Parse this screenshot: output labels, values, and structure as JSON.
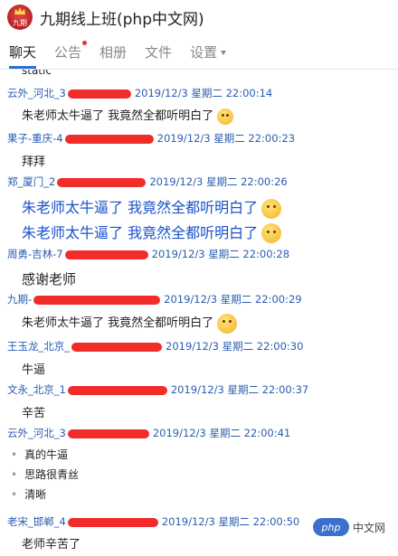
{
  "header": {
    "title": "九期线上班(php中文网)",
    "logo_text": "九期"
  },
  "tabs": [
    {
      "label": "聊天"
    },
    {
      "label": "公告"
    },
    {
      "label": "相册"
    },
    {
      "label": "文件"
    },
    {
      "label": "设置"
    }
  ],
  "messages": {
    "prev_text": "static",
    "m1": {
      "sender": "云外_河北_3",
      "time": "2019/12/3 星期二 22:00:14",
      "text": "朱老师太牛逼了 我竟然全都听明白了"
    },
    "m2": {
      "sender": "果子-重庆-4",
      "time": "2019/12/3 星期二 22:00:23",
      "text": "拜拜"
    },
    "m3": {
      "sender": "郑_厦门_2",
      "time": "2019/12/3 星期二 22:00:26",
      "text1": "朱老师太牛逼了 我竟然全都听明白了",
      "text2": "朱老师太牛逼了 我竟然全都听明白了"
    },
    "m4": {
      "sender": "周勇-吉林-7",
      "time": "2019/12/3 星期二 22:00:28",
      "text": "感谢老师"
    },
    "m5": {
      "sender": "九期-",
      "time": "2019/12/3 星期二 22:00:29",
      "text": "朱老师太牛逼了 我竟然全都听明白了"
    },
    "m6": {
      "sender": "王玉龙_北京_",
      "time": "2019/12/3 星期二 22:00:30",
      "text": "牛逼"
    },
    "m7": {
      "sender": "文永_北京_1",
      "time": "2019/12/3 星期二 22:00:37",
      "text": "辛苦"
    },
    "m8": {
      "sender": "云外_河北_3",
      "time": "2019/12/3 星期二 22:00:41",
      "bullets": [
        "真的牛逼",
        "思路很青丝",
        "清晰"
      ]
    },
    "m9": {
      "sender": "老宋_邯郸_4",
      "time": "2019/12/3 星期二 22:00:50",
      "text": "老师辛苦了"
    }
  },
  "watermark": {
    "logo": "php",
    "text": "中文网"
  },
  "colors": {
    "sender": "#2a5db0",
    "redaction": "#f22b2b",
    "accent": "#2a70d6"
  }
}
